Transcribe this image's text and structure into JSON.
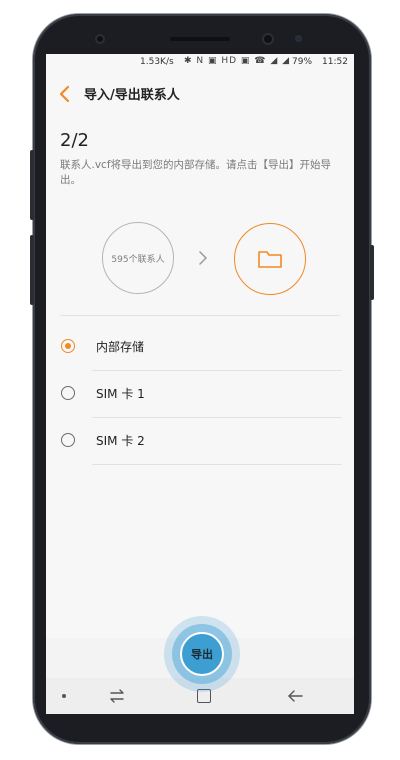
{
  "status_bar": {
    "speed": "1.53K/s",
    "icons": "✱ N ▣ HD ▣ ☎ ◢ ◢",
    "battery": "79%",
    "time": "11:52"
  },
  "app_bar": {
    "title": "导入/导出联系人"
  },
  "content": {
    "step": "2/2",
    "description": "联系人.vcf将导出到您的内部存储。请点击【导出】开始导出。",
    "contacts_count": "595个联系人"
  },
  "options": [
    {
      "label": "内部存储",
      "checked": true
    },
    {
      "label": "SIM 卡 1",
      "checked": false
    },
    {
      "label": "SIM 卡 2",
      "checked": false
    }
  ],
  "export_button": {
    "label": "导出"
  },
  "colors": {
    "accent": "#f08a24",
    "button": "#3d9fd1"
  }
}
